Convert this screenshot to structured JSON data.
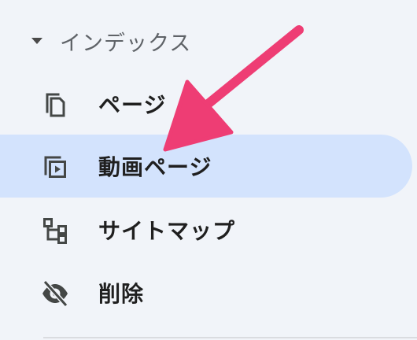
{
  "section": {
    "title": "インデックス",
    "caret_icon": "caret-down-icon"
  },
  "items": [
    {
      "label": "ページ",
      "icon": "pages-copy-icon",
      "selected": false
    },
    {
      "label": "動画ページ",
      "icon": "video-pages-icon",
      "selected": true
    },
    {
      "label": "サイトマップ",
      "icon": "sitemap-icon",
      "selected": false
    },
    {
      "label": "削除",
      "icon": "visibility-off-icon",
      "selected": false
    }
  ],
  "colors": {
    "selected_background": "#d3e3fd",
    "arrow": "#ee3d74",
    "icon": "#444746"
  }
}
